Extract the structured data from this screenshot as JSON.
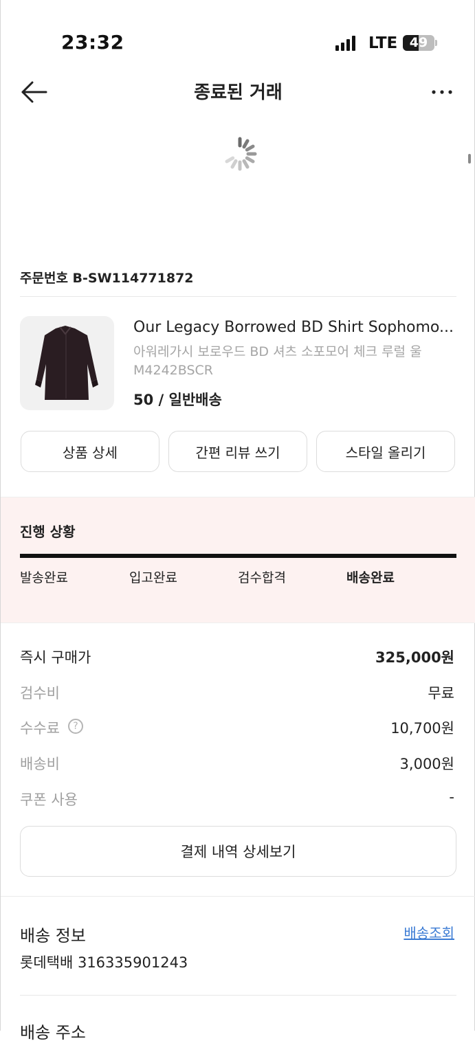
{
  "status_bar": {
    "time": "23:32",
    "network": "LTE",
    "battery_level": "49",
    "battery_fraction": 0.49
  },
  "header": {
    "title": "종료된 거래",
    "back_icon": "arrow-left-icon",
    "more_icon": "more-horizontal-icon"
  },
  "order": {
    "number_label": "주문번호 B-SW114771872"
  },
  "product": {
    "name_en": "Our Legacy Borrowed BD Shirt Sophomo...",
    "name_ko": "아워레가시 보로우드 BD 셔츠 소포모어 체크 루럴 울",
    "model": "M4242BSCR",
    "option": "50 / 일반배송"
  },
  "actions": {
    "detail": "상품 상세",
    "review": "간편 리뷰 쓰기",
    "style": "스타일 올리기"
  },
  "progress": {
    "title": "진행 상황",
    "steps": [
      "발송완료",
      "입고완료",
      "검수합격",
      "배송완료"
    ],
    "current_step_index": 3,
    "fraction": 1.0
  },
  "payment": {
    "rows": [
      {
        "label": "즉시 구매가",
        "value": "325,000원"
      },
      {
        "label": "검수비",
        "value": "무료"
      },
      {
        "label": "수수료",
        "value": "10,700원"
      },
      {
        "label": "배송비",
        "value": "3,000원"
      },
      {
        "label": "쿠폰 사용",
        "value": "-"
      }
    ],
    "detail_button": "결제 내역 상세보기"
  },
  "shipping": {
    "title": "배송 정보",
    "track_link": "배송조회",
    "courier": "롯데택배 316335901243"
  },
  "address": {
    "title": "배송 주소"
  },
  "colors": {
    "accent_link": "#3b7bd4",
    "progress_bg": "#fdf2f1",
    "progress_bar": "#111111"
  }
}
